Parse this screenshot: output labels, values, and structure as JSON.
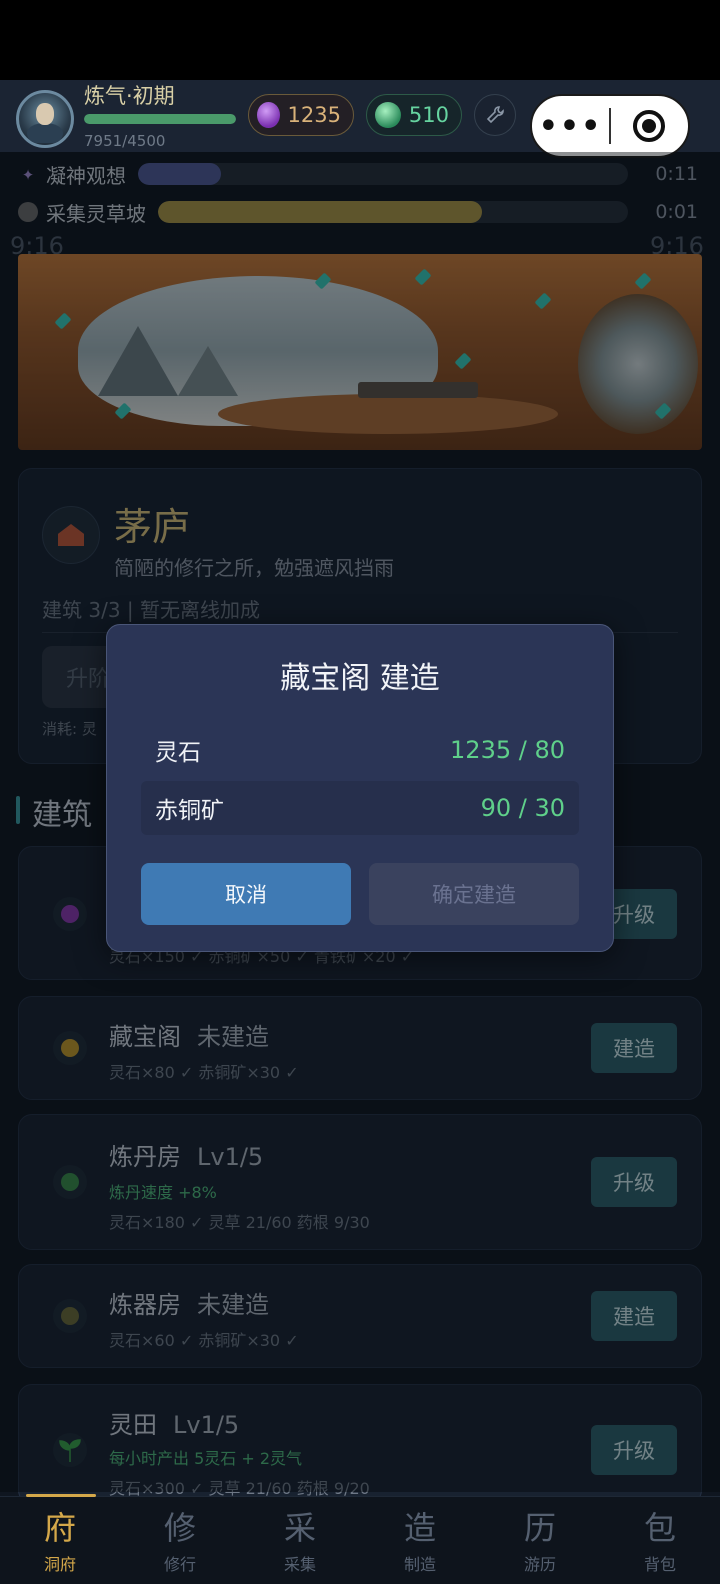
{
  "header": {
    "realm": "炼气·初期",
    "xp_text": "7951/4500",
    "xp_progress": 1.0,
    "spirit_stone": "1235",
    "qi": "510",
    "wrench_icon": "wrench-icon",
    "capsule_more": "•••"
  },
  "ghost_time": "9:16",
  "tasks": [
    {
      "name": "凝神观想",
      "time": "0:11",
      "progress": 0.17,
      "color": "#4f5a96"
    },
    {
      "name": "采集灵草坡",
      "time": "0:01",
      "progress": 0.69,
      "color": "#a89445"
    }
  ],
  "card": {
    "title": "茅庐",
    "desc": "简陋的修行之所，勉强遮风挡雨",
    "meta": "建筑 3/3  |  暂无离线加成",
    "upgrade_label": "升阶",
    "cost_label": "消耗: 灵"
  },
  "section_title": "建筑",
  "buildings": [
    {
      "name": "",
      "status": "",
      "bonus": "",
      "cost": "灵石×150 ✓  赤铜矿×50 ✓  青铁矿×20 ✓",
      "button": "升级",
      "icon_color": "#8a3ab0"
    },
    {
      "name": "藏宝阁",
      "status": "未建造",
      "bonus": "",
      "cost": "灵石×80 ✓  赤铜矿×30 ✓",
      "button": "建造",
      "icon_color": "#c0982a"
    },
    {
      "name": "炼丹房",
      "status": "Lv1/5",
      "bonus": "炼丹速度 +8%",
      "cost": "灵石×180 ✓  灵草 21/60  药根 9/30",
      "button": "升级",
      "icon_color": "#3a8a4a"
    },
    {
      "name": "炼器房",
      "status": "未建造",
      "bonus": "",
      "cost": "灵石×60 ✓  赤铜矿×30 ✓",
      "button": "建造",
      "icon_color": "#6a6a3a"
    },
    {
      "name": "灵田",
      "status": "Lv1/5",
      "bonus": "每小时产出 5灵石 + 2灵气",
      "cost": "灵石×300 ✓  灵草 21/60  药根 9/20",
      "button": "升级",
      "icon_color": "#3aa04a"
    }
  ],
  "dialog": {
    "title": "藏宝阁 建造",
    "rows": [
      {
        "label": "灵石",
        "value": "1235 / 80"
      },
      {
        "label": "赤铜矿",
        "value": "90 / 30"
      }
    ],
    "cancel": "取消",
    "confirm": "确定建造"
  },
  "nav": [
    {
      "glyph": "府",
      "label": "洞府",
      "active": true
    },
    {
      "glyph": "修",
      "label": "修行",
      "active": false
    },
    {
      "glyph": "采",
      "label": "采集",
      "active": false
    },
    {
      "glyph": "造",
      "label": "制造",
      "active": false
    },
    {
      "glyph": "历",
      "label": "游历",
      "active": false
    },
    {
      "glyph": "包",
      "label": "背包",
      "active": false
    }
  ],
  "colors": {
    "accent_gold": "#d4a84a",
    "teal_button": "#2d5f6a",
    "dialog_bg": "#2b3556",
    "cancel_blue": "#3f7ab4",
    "value_green": "#5fd08a"
  }
}
